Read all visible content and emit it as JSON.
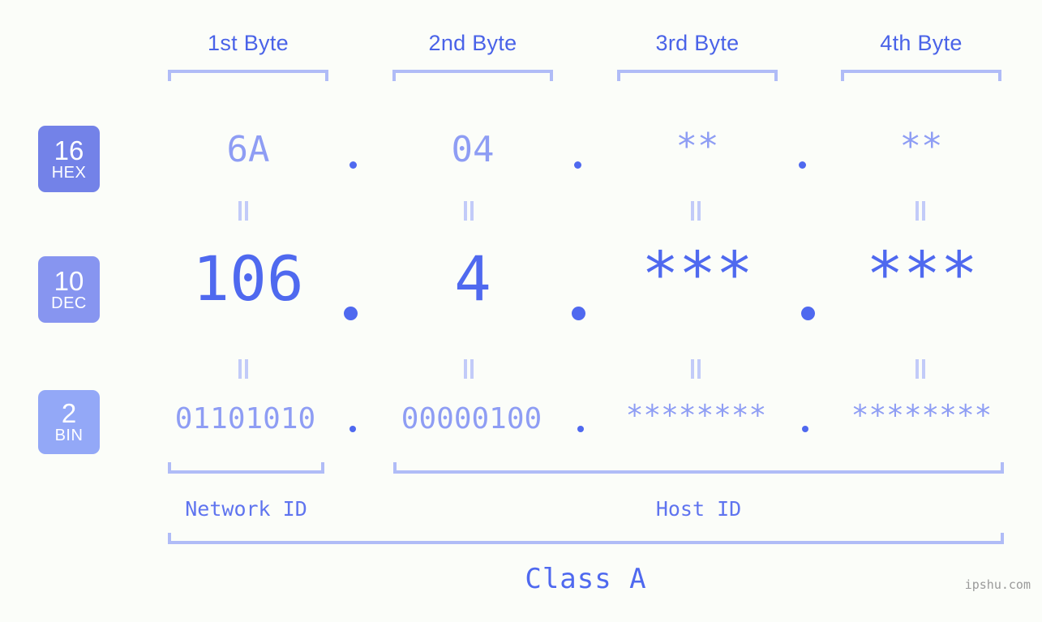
{
  "meta": {
    "background_color": "#fbfdf9",
    "accent_color": "#4f69ef",
    "light_accent_color": "#8e9df4",
    "bracket_color": "#b0bcf7"
  },
  "headers": [
    {
      "label": "1st Byte"
    },
    {
      "label": "2nd Byte"
    },
    {
      "label": "3rd Byte"
    },
    {
      "label": "4th Byte"
    }
  ],
  "bases": [
    {
      "number": "16",
      "name": "HEX",
      "color": "#7382e8"
    },
    {
      "number": "10",
      "name": "DEC",
      "color": "#8795f0"
    },
    {
      "number": "2",
      "name": "BIN",
      "color": "#93a8f7"
    }
  ],
  "rows": {
    "hex": {
      "byte1": "6A",
      "byte2": "04",
      "byte3": "**",
      "byte4": "**",
      "separator": "."
    },
    "dec": {
      "byte1": "106",
      "byte2": "4",
      "byte3": "***",
      "byte4": "***",
      "separator": "."
    },
    "bin": {
      "byte1": "01101010",
      "byte2": "00000100",
      "byte3": "********",
      "byte4": "********",
      "separator": "."
    }
  },
  "equals_marks": {
    "symbol": "=",
    "count_per_gap": 4
  },
  "footer": {
    "network_id": "Network ID",
    "host_id": "Host ID",
    "class": "Class A"
  },
  "watermark": "ipshu.com"
}
